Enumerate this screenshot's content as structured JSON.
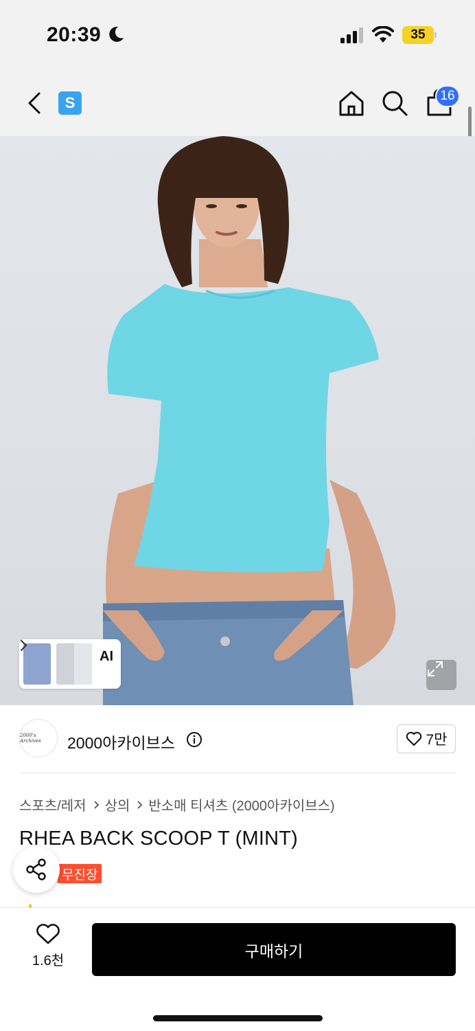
{
  "status_bar": {
    "time": "20:39",
    "battery": "35",
    "icons": [
      "moon-icon",
      "signal-icon",
      "wifi-icon",
      "battery-icon"
    ]
  },
  "nav": {
    "store_badge": "S",
    "cart_count": "16",
    "icons": [
      "back-icon",
      "home-icon",
      "search-icon",
      "shopping-bag-icon"
    ]
  },
  "hero": {
    "ai_label": "AI"
  },
  "brand": {
    "logo_text": "2000's Archives",
    "name": "2000아카이브스",
    "likes": "7만"
  },
  "breadcrumb": {
    "items": [
      "스포츠/레저",
      "상의",
      "반소매 티셔츠 (2000아카이브스)"
    ]
  },
  "product": {
    "title": "RHEA BACK SCOOP T (MINT)",
    "badge": "무진장"
  },
  "bottom_bar": {
    "wish_count": "1.6천",
    "buy_label": "구매하기"
  },
  "colors": {
    "accent_blue": "#2f6fff",
    "store_badge": "#3aa3f0",
    "sale_badge": "#ff4d2e",
    "battery": "#f5d224",
    "shirt_mint": "#6fd6e6"
  }
}
